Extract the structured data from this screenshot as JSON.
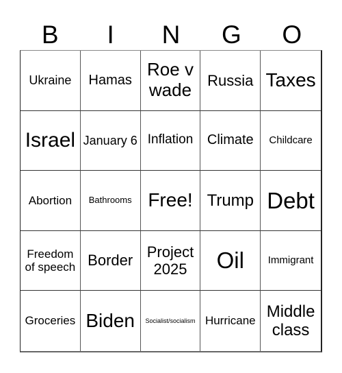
{
  "header": {
    "letters": [
      "B",
      "I",
      "N",
      "G",
      "O"
    ]
  },
  "cells": [
    "Ukraine",
    "Hamas",
    "Roe v wade",
    "Russia",
    "Taxes",
    "Israel",
    "January 6",
    "Inflation",
    "Climate",
    "Childcare",
    "Abortion",
    "Bathrooms",
    "Free!",
    "Trump",
    "Debt",
    "Freedom of speech",
    "Border",
    "Project 2025",
    "Oil",
    "Immigrant",
    "Groceries",
    "Biden",
    "Socialist/socialism",
    "Hurricane",
    "Middle class"
  ],
  "free_space": {
    "label": "Free!"
  }
}
